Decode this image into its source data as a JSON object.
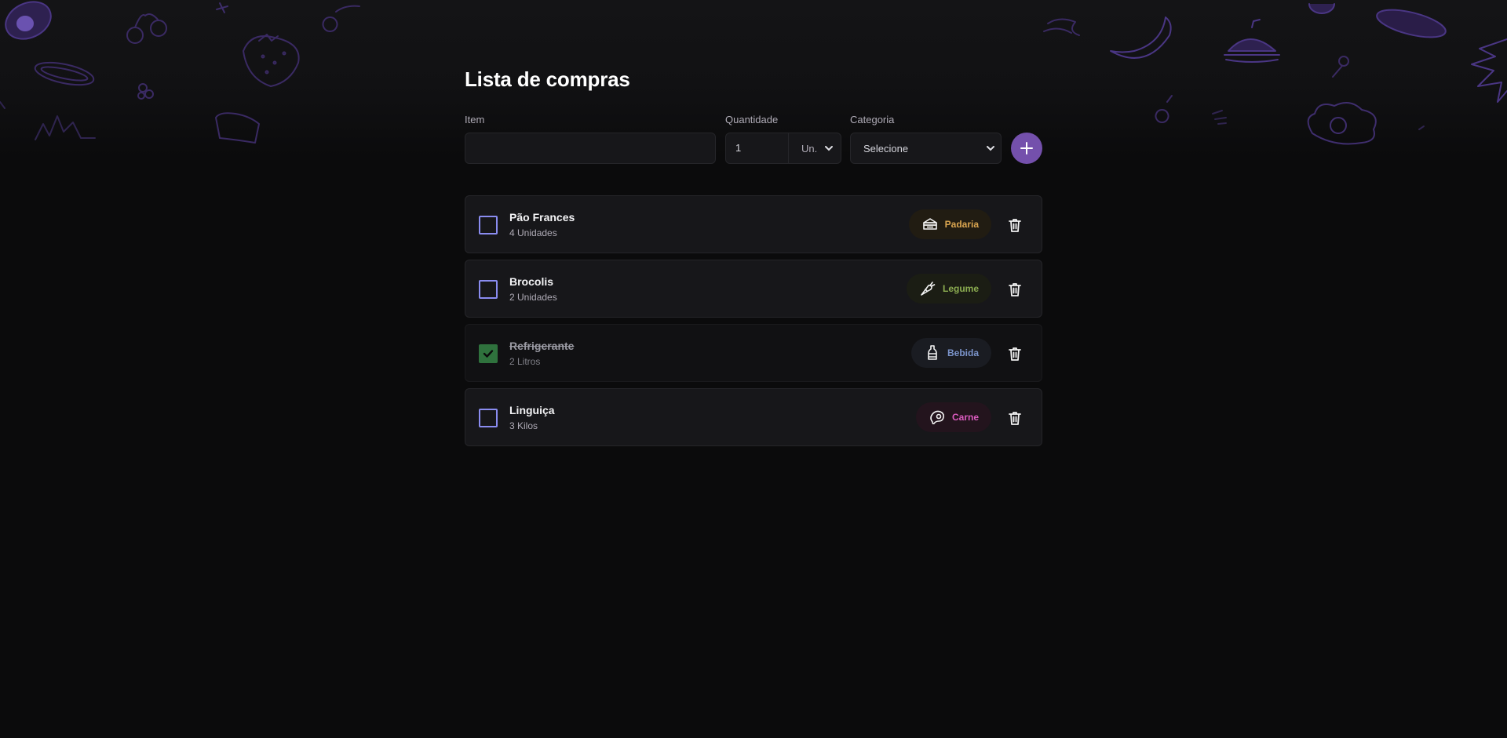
{
  "title": "Lista de compras",
  "form": {
    "item_label": "Item",
    "item_value": "",
    "quantity_label": "Quantidade",
    "quantity_value": "1",
    "unit_value": "Un.",
    "category_label": "Categoria",
    "category_value": "Selecione"
  },
  "colors": {
    "background": "#0b0b0c",
    "accent": "#7450ac",
    "checkbox_border": "#8a8cf0",
    "checked": "#2f723d"
  },
  "items": [
    {
      "name": "Pão Frances",
      "quantity": "4 Unidades",
      "checked": false,
      "category": "Padaria",
      "category_icon": "sandwich-icon",
      "category_color": "#dba650",
      "category_bg": "#211c12"
    },
    {
      "name": "Brocolis",
      "quantity": "2 Unidades",
      "checked": false,
      "category": "Legume",
      "category_icon": "carrot-icon",
      "category_color": "#8cad51",
      "category_bg": "#1b1d14"
    },
    {
      "name": "Refrigerante",
      "quantity": "2 Litros",
      "checked": true,
      "category": "Bebida",
      "category_icon": "bottle-icon",
      "category_color": "#7b94cb",
      "category_bg": "#1a1c22"
    },
    {
      "name": "Linguiça",
      "quantity": "3 Kilos",
      "checked": false,
      "category": "Carne",
      "category_icon": "meat-icon",
      "category_color": "#db5bbf",
      "category_bg": "#23141d"
    }
  ]
}
